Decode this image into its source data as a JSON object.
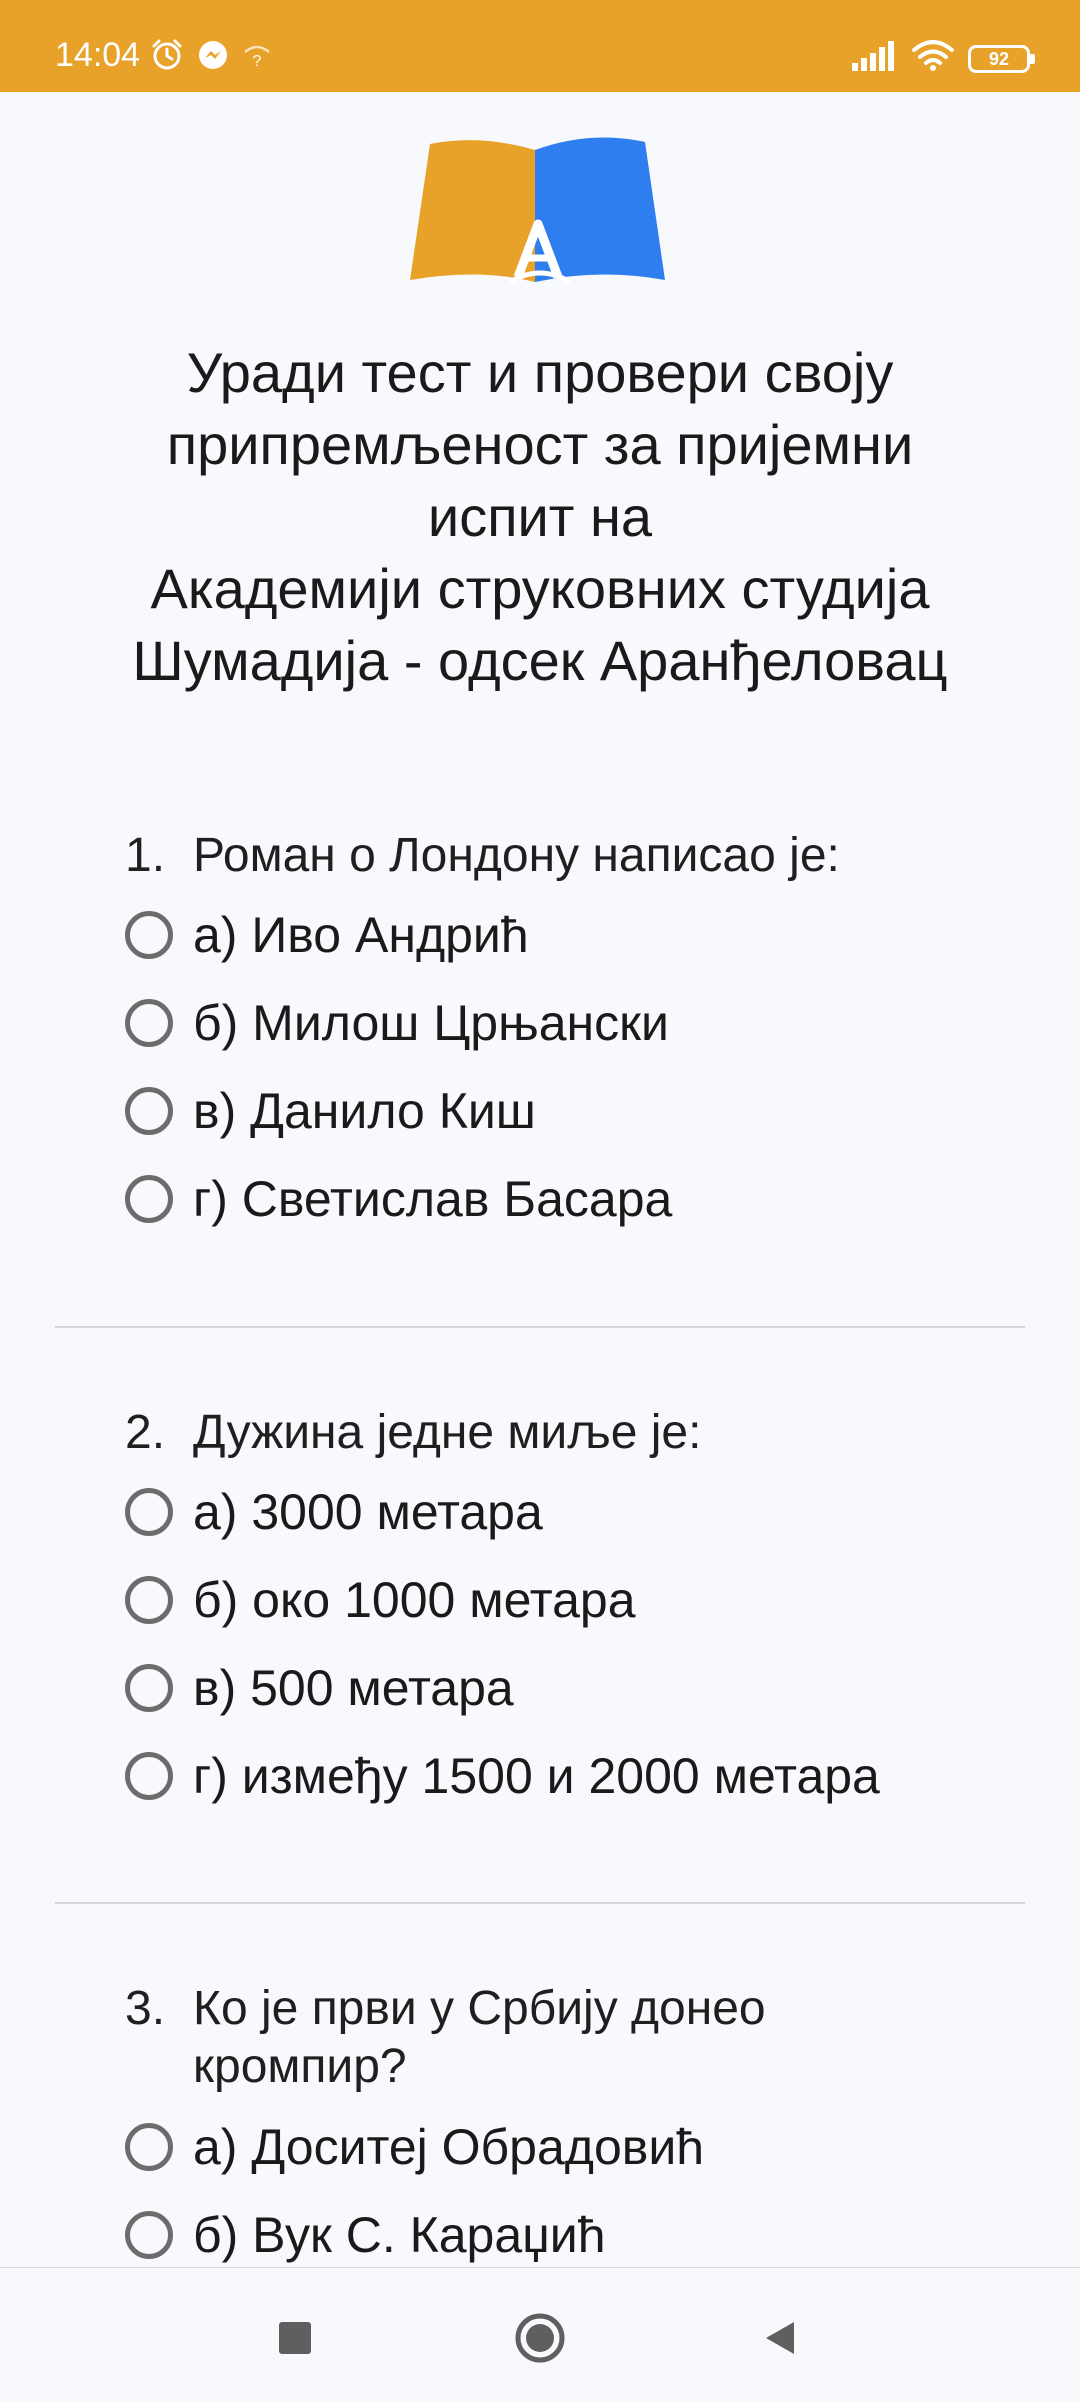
{
  "status_bar": {
    "time": "14:04",
    "battery": "92"
  },
  "header": {
    "intro_text": "Уради тест и провери своју\nприпремљеност за пријемни\nиспит на\n Академији струковних студија\nШумадија - одсек Аранђеловац"
  },
  "questions": [
    {
      "number": "1.",
      "text": "Роман о Лондону написао је:",
      "options": [
        "а) Иво Андрић",
        "б) Милош Црњански",
        "в) Данило Киш",
        "г) Светислав Басара"
      ]
    },
    {
      "number": "2.",
      "text": "Дужина једне миље је:",
      "options": [
        "а) 3000 метара",
        "б) око 1000 метара",
        "в) 500 метара",
        "г) између 1500 и 2000 метара"
      ]
    },
    {
      "number": "3.",
      "text": "Ко је први у Србију донео кромпир?",
      "options": [
        "а) Доситеј Обрадовић",
        "б) Вук С. Караџић"
      ]
    }
  ],
  "colors": {
    "status_bar_bg": "#e8a22a",
    "page_bg": "#f8f9fd",
    "logo_orange": "#e8a22a",
    "logo_blue": "#2f7ef0",
    "radio_border": "#6c6c6c"
  },
  "icons": {
    "status_left": [
      "alarm-icon",
      "messenger-icon",
      "wifi-question-icon"
    ],
    "status_right": [
      "signal-icon",
      "wifi-icon",
      "battery-icon"
    ],
    "nav": [
      "recents-square-icon",
      "home-circle-icon",
      "back-triangle-icon"
    ]
  }
}
